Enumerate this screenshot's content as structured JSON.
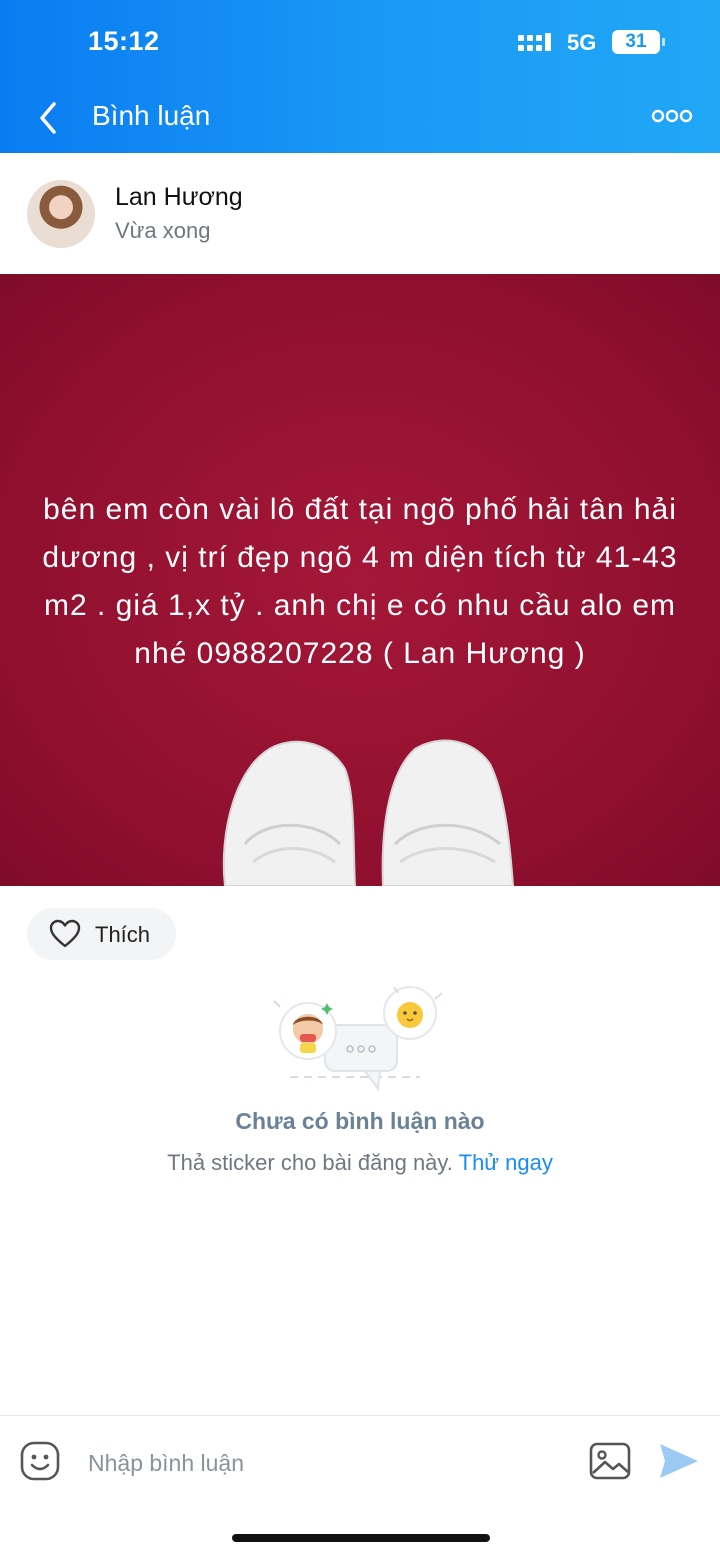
{
  "status_bar": {
    "time": "15:12",
    "network": "5G",
    "battery": "31"
  },
  "header": {
    "title": "Bình luận",
    "back_icon": "chevron-left-icon",
    "more_icon": "more-dots-icon"
  },
  "post": {
    "author": "Lan Hương",
    "time": "Vừa xong",
    "text": "bên em còn vài lô đất tại ngõ phố hải tân hải dương , vị trí đẹp ngõ 4 m diện tích từ 41-43 m2 . giá 1,x tỷ . anh chị e có nhu cầu alo em nhé 0988207228 ( Lan Hương )",
    "background_color": "#8f0f2e"
  },
  "actions": {
    "like_label": "Thích",
    "like_icon": "heart-icon"
  },
  "comments": {
    "empty_title": "Chưa có bình luận nào",
    "empty_subtitle": "Thả sticker cho bài đăng này.",
    "try_link": "Thử ngay"
  },
  "composer": {
    "placeholder": "Nhập bình luận",
    "sticker_icon": "sticker-smile-icon",
    "image_icon": "image-icon",
    "send_icon": "send-icon"
  },
  "colors": {
    "accent": "#1a8ef0",
    "header_start": "#0a7cf2",
    "header_end": "#21a7f6"
  }
}
